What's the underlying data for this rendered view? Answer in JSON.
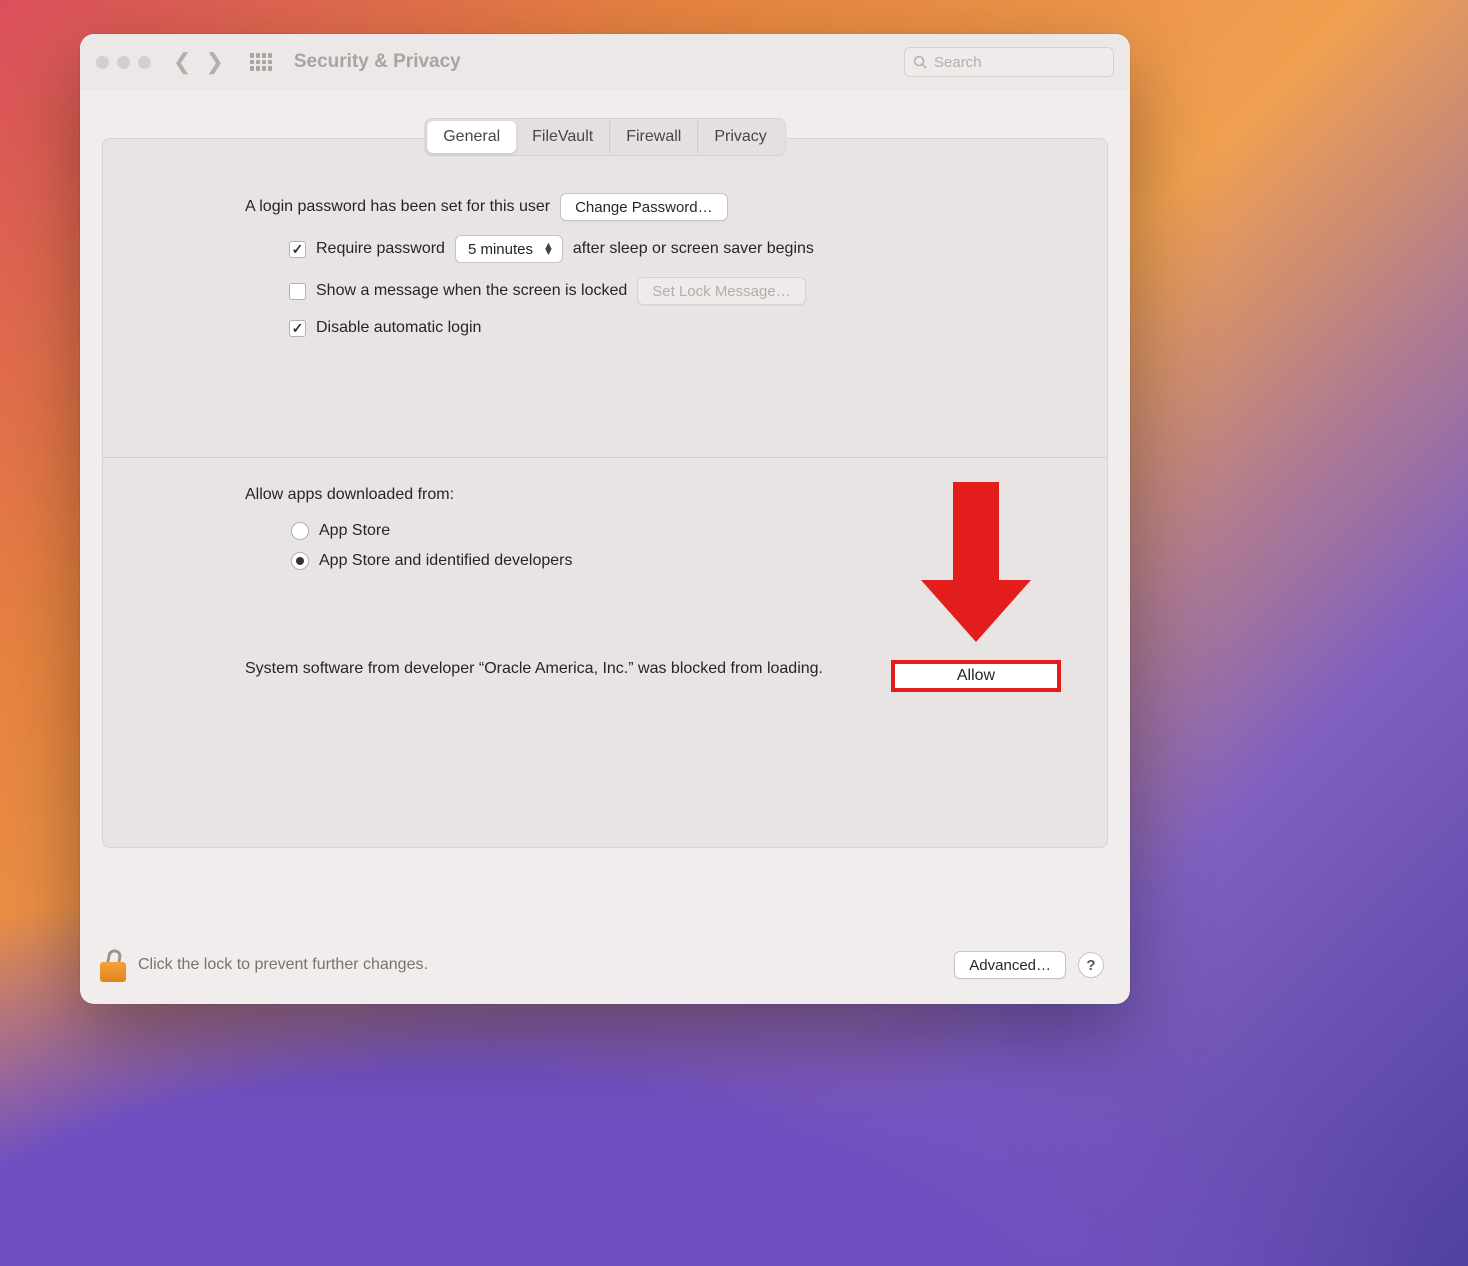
{
  "window": {
    "title": "Security & Privacy"
  },
  "search": {
    "placeholder": "Search"
  },
  "tabs": {
    "general": "General",
    "filevault": "FileVault",
    "firewall": "Firewall",
    "privacy": "Privacy",
    "active": "General"
  },
  "login": {
    "password_set_text": "A login password has been set for this user",
    "change_password_btn": "Change Password…",
    "require_password_label": "Require password",
    "require_password_checked": true,
    "delay_value": "5 minutes",
    "after_sleep_text": "after sleep or screen saver begins",
    "show_message_label": "Show a message when the screen is locked",
    "show_message_checked": false,
    "set_lock_message_btn": "Set Lock Message…",
    "disable_auto_login_label": "Disable automatic login",
    "disable_auto_login_checked": true
  },
  "allow_apps": {
    "heading": "Allow apps downloaded from:",
    "option_appstore": "App Store",
    "option_identified": "App Store and identified developers",
    "selected": "identified"
  },
  "blocked": {
    "text": "System software from developer “Oracle America, Inc.” was blocked from loading.",
    "allow_btn": "Allow"
  },
  "footer": {
    "lock_text": "Click the lock to prevent further changes.",
    "advanced_btn": "Advanced…",
    "help": "?"
  },
  "annotation": {
    "arrow_color": "#e31c1c"
  }
}
